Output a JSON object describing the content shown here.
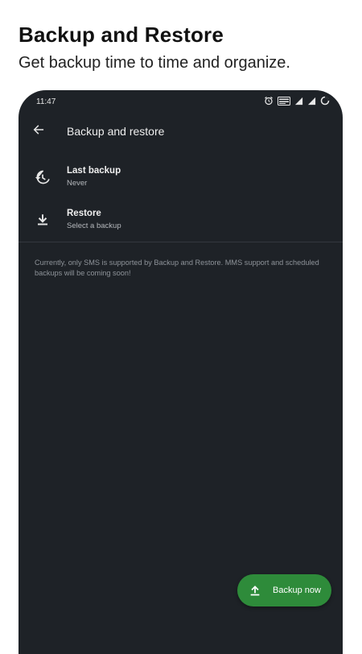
{
  "promo": {
    "title": "Backup and Restore",
    "subtitle": "Get backup time to time and organize."
  },
  "status_bar": {
    "time": "11:47",
    "icons": [
      "alarm-icon",
      "volte-icon",
      "signal-icon",
      "signal-icon",
      "battery-icon"
    ]
  },
  "toolbar": {
    "title": "Backup and restore",
    "back_icon": "arrow-back-icon"
  },
  "preferences": [
    {
      "icon": "history-icon",
      "label": "Last backup",
      "summary": "Never"
    },
    {
      "icon": "download-icon",
      "label": "Restore",
      "summary": "Select a backup"
    }
  ],
  "info": {
    "text": "Currently, only SMS is supported by Backup and Restore. MMS support and scheduled backups will be coming soon!"
  },
  "fab": {
    "icon": "upload-icon",
    "label": "Backup now",
    "color": "#2e8b3a"
  },
  "colors": {
    "background": "#1e2227",
    "divider": "#33383e",
    "accent": "#2e8b3a"
  }
}
